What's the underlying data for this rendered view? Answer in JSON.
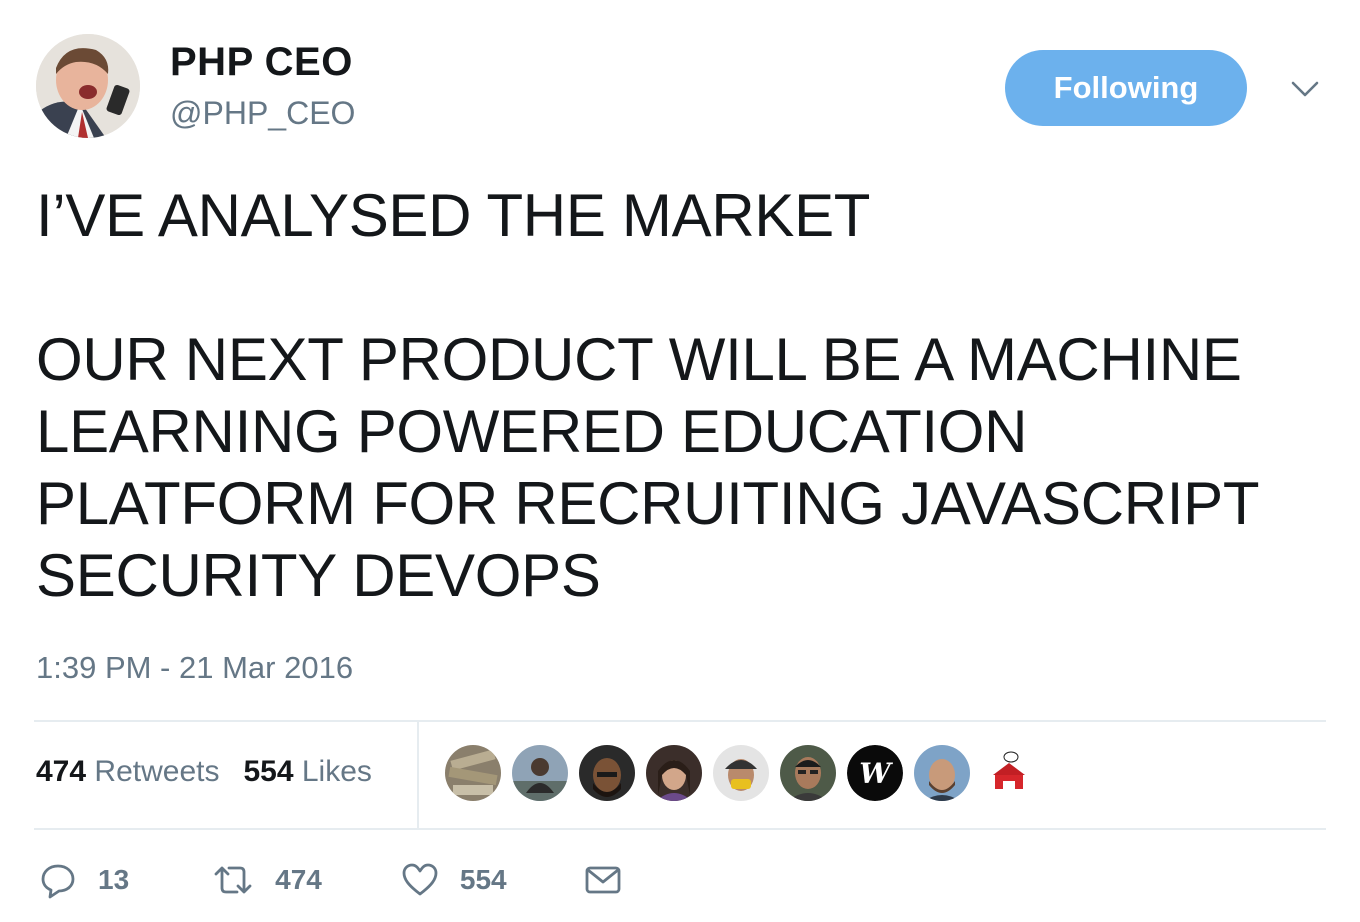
{
  "user": {
    "name": "PHP CEO",
    "handle": "@PHP_CEO"
  },
  "follow_button_label": "Following",
  "tweet": {
    "text": "I’VE ANALYSED THE MARKET\n\nOUR NEXT PRODUCT WILL BE A MACHINE LEARNING POWERED EDUCATION PLATFORM FOR RECRUITING JAVASCRIPT SECURITY DEVOPS",
    "timestamp": "1:39 PM - 21 Mar 2016"
  },
  "stats": {
    "retweets_count": "474",
    "retweets_label": "Retweets",
    "likes_count": "554",
    "likes_label": "Likes"
  },
  "actions": {
    "reply_count": "13",
    "retweet_count": "474",
    "like_count": "554"
  },
  "likers": [
    {
      "name": "liker-1"
    },
    {
      "name": "liker-2"
    },
    {
      "name": "liker-3"
    },
    {
      "name": "liker-4"
    },
    {
      "name": "liker-5"
    },
    {
      "name": "liker-6"
    },
    {
      "name": "liker-7",
      "text": "W"
    },
    {
      "name": "liker-8"
    },
    {
      "name": "liker-9"
    }
  ],
  "colors": {
    "accent": "#6cb1ed",
    "muted": "#657786",
    "text": "#14171a",
    "divider": "#e6ecf0"
  }
}
